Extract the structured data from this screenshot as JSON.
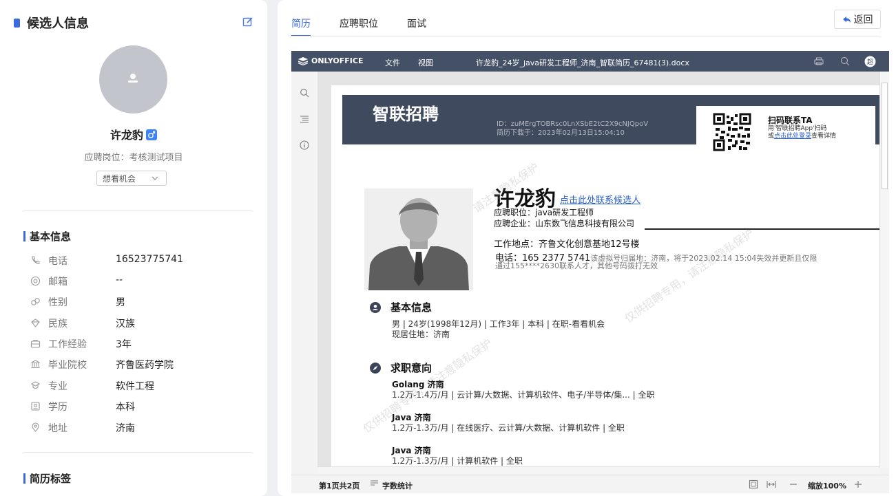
{
  "left": {
    "title": "候选人信息",
    "name": "许龙豹",
    "position_label": "应聘岗位：考核测试项目",
    "status": "想看机会",
    "basic_title": "基本信息",
    "fields": [
      {
        "label": "电话",
        "value": "16523775741",
        "icon": "phone-icon"
      },
      {
        "label": "邮箱",
        "value": "--",
        "icon": "at-icon"
      },
      {
        "label": "性别",
        "value": "男",
        "icon": "gender-icon"
      },
      {
        "label": "民族",
        "value": "汉族",
        "icon": "ethnicity-icon"
      },
      {
        "label": "工作经验",
        "value": "3年",
        "icon": "briefcase-icon"
      },
      {
        "label": "毕业院校",
        "value": "齐鲁医药学院",
        "icon": "school-icon"
      },
      {
        "label": "专业",
        "value": "软件工程",
        "icon": "major-icon"
      },
      {
        "label": "学历",
        "value": "本科",
        "icon": "degree-icon"
      },
      {
        "label": "地址",
        "value": "济南",
        "icon": "location-icon"
      }
    ],
    "tags_title": "简历标签"
  },
  "right": {
    "tabs": [
      "简历",
      "应聘职位",
      "面试"
    ],
    "back": "返回"
  },
  "viewer": {
    "brand": "ONLYOFFICE",
    "menu_file": "文件",
    "menu_view": "视图",
    "filename": "许龙豹_24岁_java研发工程师_济南_智联简历_67481(3).docx",
    "page_info": "第1页共2页",
    "word_count": "字数统计",
    "zoom": "缩放100%"
  },
  "doc": {
    "logo": "智联招聘",
    "id_line": "ID：zuMErgTOBRsc0LnXSbE2tC2X9cNJQpoV",
    "download_line": "简历下载于：2023年02月13日15:04:10",
    "scan_title": "扫码联系TA",
    "scan_line1": "用'智联招聘App'扫码",
    "scan_or": "或",
    "scan_link": "点击此处登录",
    "scan_after": "查看详情",
    "name": "许龙豹",
    "contact_link": "点击此处联系候选人",
    "job": "应聘职位：java研发工程师",
    "company": "应聘企业：山东数飞信息科技有限公司",
    "work_location": "工作地点：齐鲁文化创意基地12号楼",
    "phone": "电话：165 2377 5741",
    "phone_note": "该虚拟号归属地：济南，将于2023.02.14 15:04失效并更新且仅限",
    "phone_note2": "通过155****2630联系人才，其他号码拨打无效",
    "basic_title": "基本信息",
    "basic_line1": "男 | 24岁(1998年12月) | 工作3年 | 本科 | 在职-看看机会",
    "basic_line2": "现居住地：济南",
    "intent_title": "求职意向",
    "intents": [
      {
        "title": "Golang   济南",
        "detail": "1.2万-1.4万/月 | 云计算/大数据、计算机软件、电子/半导体/集... | 全职"
      },
      {
        "title": "Java   济南",
        "detail": "1.2万-1.3万/月 | 在线医疗、云计算/大数据、计算机软件 | 全职"
      },
      {
        "title": "Java   济南",
        "detail": "1.2万-1.3万/月 | 计算机软件 | 全职"
      }
    ],
    "watermark1": "请注意隐私保护",
    "watermark2": "仅供招聘专用，请注意隐私保护",
    "watermark3": "仅供招聘专用，请注意隐私保护"
  },
  "colors": {
    "accent": "#3a6bdc",
    "header": "#445066"
  }
}
